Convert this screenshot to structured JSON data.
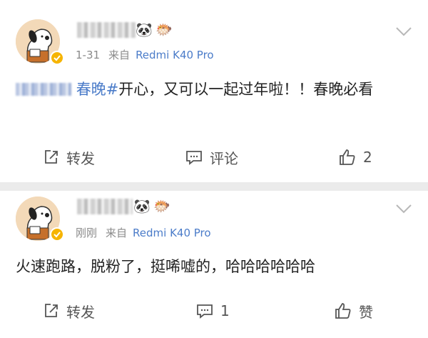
{
  "posts": [
    {
      "name_emojis": [
        "🐼",
        "🐡"
      ],
      "time": "1-31",
      "source_prefix": "来自",
      "source": "Redmi K40 Pro",
      "hashtag_suffix": "春晚#",
      "text": "开心，又可以一起过年啦！！春晚必看",
      "actions": {
        "repost": "转发",
        "comment": "评论",
        "like": "2"
      }
    },
    {
      "name_emojis": [
        "🐼",
        "🐡"
      ],
      "time": "刚刚",
      "source_prefix": "来自",
      "source": "Redmi K40 Pro",
      "text": "火速跑路，脱粉了，挺唏嘘的，哈哈哈哈哈哈",
      "actions": {
        "repost": "转发",
        "comment": "1",
        "like": "赞"
      }
    }
  ],
  "colors": {
    "link": "#4b7cc9",
    "meta": "#8a8a8a",
    "text": "#222222",
    "badge": "#f6b400",
    "separator": "#ebebeb"
  },
  "icons": [
    "snoopy-avatar",
    "verified-badge-icon",
    "chevron-down-icon",
    "repost-icon",
    "comment-icon",
    "like-icon"
  ]
}
